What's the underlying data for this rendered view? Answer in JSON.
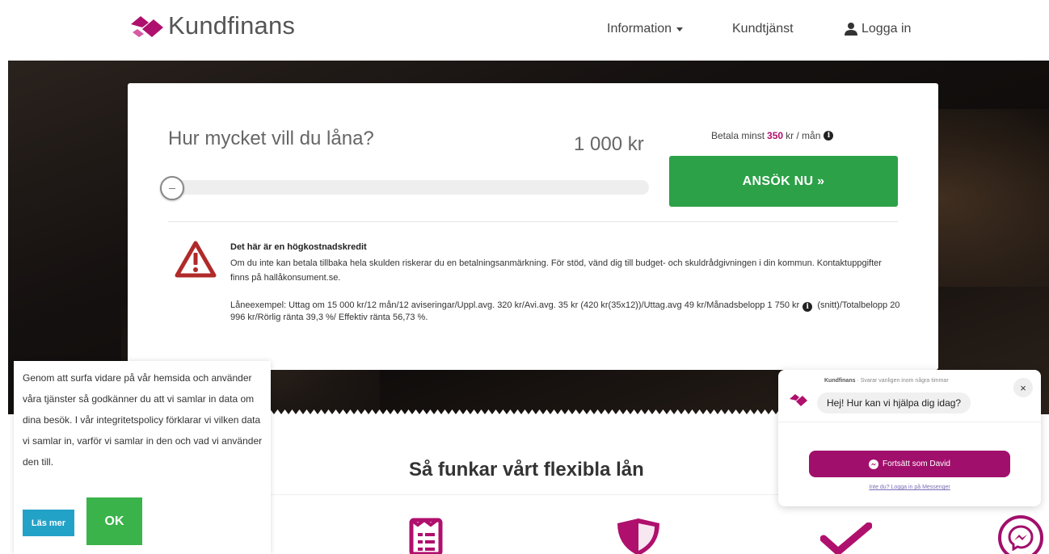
{
  "header": {
    "logo_text": "Kundfinans",
    "nav": {
      "information": "Information",
      "customer_service": "Kundtjänst",
      "login": "Logga in"
    }
  },
  "calculator": {
    "question": "Hur mycket vill du låna?",
    "amount": "1 000 kr",
    "slider_value_fraction": 0.0,
    "min_payment_prefix": "Betala minst",
    "min_payment_value": "350",
    "min_payment_suffix": "kr / mån",
    "apply_label": "ANSÖK NU »",
    "warning_title": "Det här är en högkostnadskredit",
    "warning_text": "Om du inte kan betala tillbaka hela skulden riskerar du en betalningsanmärkning. För stöd, vänd dig till budget- och skuldrådgivningen i din kommun. Kontaktuppgifter finns på hallåkonsument.se.",
    "loan_example_part1": "Låneexempel: Uttag om 15 000 kr/12 mån/12 aviseringar/Uppl.avg. 320 kr/Avi.avg. 35 kr (420 kr(35x12))/Uttag.avg 49 kr/Månadsbelopp 1 750 kr",
    "loan_example_part2": "(snitt)/Totalbelopp 20 996 kr/Rörlig ränta 39,3 %/ Effektiv ränta 56,73 %."
  },
  "section": {
    "title": "Så funkar vårt flexibla lån"
  },
  "cookie": {
    "text": "Genom att surfa vidare på vår hemsida och använder våra tjänster så godkänner du att vi samlar in data om dina besök. I vår integritetspolicy förklarar vi vilken data vi samlar in, varför vi samlar in den och vad vi använder den till.",
    "read_more": "Läs mer",
    "ok": "OK"
  },
  "chat": {
    "sender": "Kundfinans",
    "response_time": " · Svarar vanligen inom några timmar",
    "close": "×",
    "greeting": "Hej! Hur kan vi hjälpa dig idag?",
    "continue_label": "Fortsätt som David",
    "other_login": "Inte du? Logga in på Messenger"
  },
  "colors": {
    "brand": "#b0106d",
    "apply_green": "#2ca148",
    "ok_green": "#3ab34a",
    "read_more_blue": "#23a2c7",
    "messenger_purple": "#a10f6c"
  },
  "icons": {
    "logo": "kundfinans-logo-icon",
    "info": "info-circle-icon",
    "user": "user-icon",
    "warning": "warning-triangle-icon",
    "messenger": "messenger-icon"
  }
}
